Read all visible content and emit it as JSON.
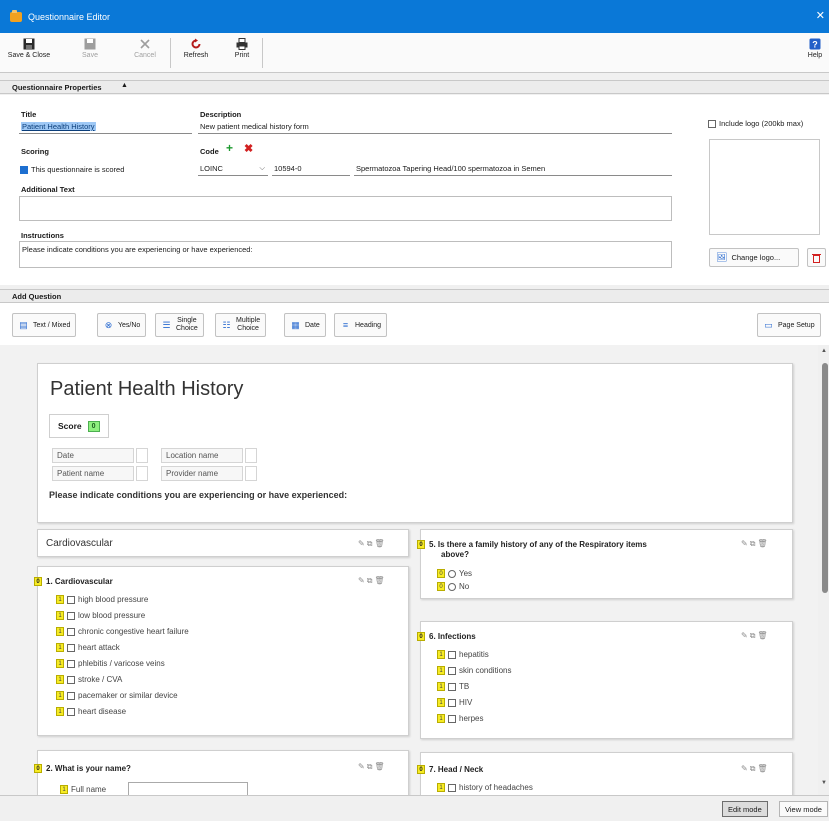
{
  "window": {
    "title": "Questionnaire Editor",
    "close_glyph": "✕"
  },
  "toolbar": {
    "save_close": "Save & Close",
    "save": "Save",
    "cancel": "Cancel",
    "refresh": "Refresh",
    "print": "Print",
    "help": "Help"
  },
  "properties": {
    "header": "Questionnaire Properties",
    "title_label": "Title",
    "title_value": "Patient Health History",
    "description_label": "Description",
    "description_value": "New patient medical history form",
    "scoring_label": "Scoring",
    "scored_checkbox_label": "This questionnaire is scored",
    "code_label": "Code",
    "code_system": "LOINC",
    "code_value": "10594-0",
    "code_description": "Spermatozoa Tapering Head/100 spermatozoa in Semen",
    "additional_text_label": "Additional Text",
    "additional_text_value": "",
    "instructions_label": "Instructions",
    "instructions_value": "Please indicate conditions you are experiencing or have experienced:",
    "include_logo_label": "Include logo (200kb max)",
    "change_logo": "Change logo..."
  },
  "add_question": {
    "header": "Add Question",
    "text_mixed": "Text / Mixed",
    "yes_no": "Yes/No",
    "single_choice_1": "Single",
    "single_choice_2": "Choice",
    "multiple_choice_1": "Multiple",
    "multiple_choice_2": "Choice",
    "date": "Date",
    "heading": "Heading",
    "page_setup": "Page Setup"
  },
  "preview": {
    "page_title": "Patient Health History",
    "score_label": "Score",
    "score_value": "0",
    "meta": {
      "date": "Date",
      "patient": "Patient name",
      "location": "Location name",
      "provider": "Provider name"
    },
    "instructions": "Please indicate conditions you are experiencing or have experienced:",
    "section_cardiovascular": "Cardiovascular",
    "q1": {
      "badge": "0",
      "title": "1. Cardiovascular",
      "options": [
        {
          "badge": "1",
          "label": "high blood pressure"
        },
        {
          "badge": "1",
          "label": "low blood pressure"
        },
        {
          "badge": "1",
          "label": "chronic congestive heart failure"
        },
        {
          "badge": "1",
          "label": "heart attack"
        },
        {
          "badge": "1",
          "label": "phlebitis / varicose veins"
        },
        {
          "badge": "1",
          "label": "stroke / CVA"
        },
        {
          "badge": "1",
          "label": "pacemaker or similar device"
        },
        {
          "badge": "1",
          "label": "heart disease"
        }
      ]
    },
    "q2": {
      "badge": "0",
      "title": "2. What is your name?",
      "field_badge": "1",
      "field_label": "Full name"
    },
    "q5": {
      "badge": "0",
      "title_line1": "5. Is there a family history of any of the Respiratory items",
      "title_line2": "above?",
      "options": [
        {
          "badge": "0",
          "label": "Yes"
        },
        {
          "badge": "0",
          "label": "No"
        }
      ]
    },
    "q6": {
      "badge": "0",
      "title": "6. Infections",
      "options": [
        {
          "badge": "1",
          "label": "hepatitis"
        },
        {
          "badge": "1",
          "label": "skin conditions"
        },
        {
          "badge": "1",
          "label": "TB"
        },
        {
          "badge": "1",
          "label": "HIV"
        },
        {
          "badge": "1",
          "label": "herpes"
        }
      ]
    },
    "q7": {
      "badge": "0",
      "title": "7. Head / Neck",
      "options": [
        {
          "badge": "1",
          "label": "history of headaches"
        }
      ]
    }
  },
  "status": {
    "edit_mode": "Edit mode",
    "view_mode": "View mode"
  },
  "colors": {
    "titlebar": "#0a78d7",
    "badge_yellow": "#f7ec25",
    "score_green": "#8ef07f",
    "add_green": "#1e9a30",
    "delete_red": "#d22020"
  }
}
